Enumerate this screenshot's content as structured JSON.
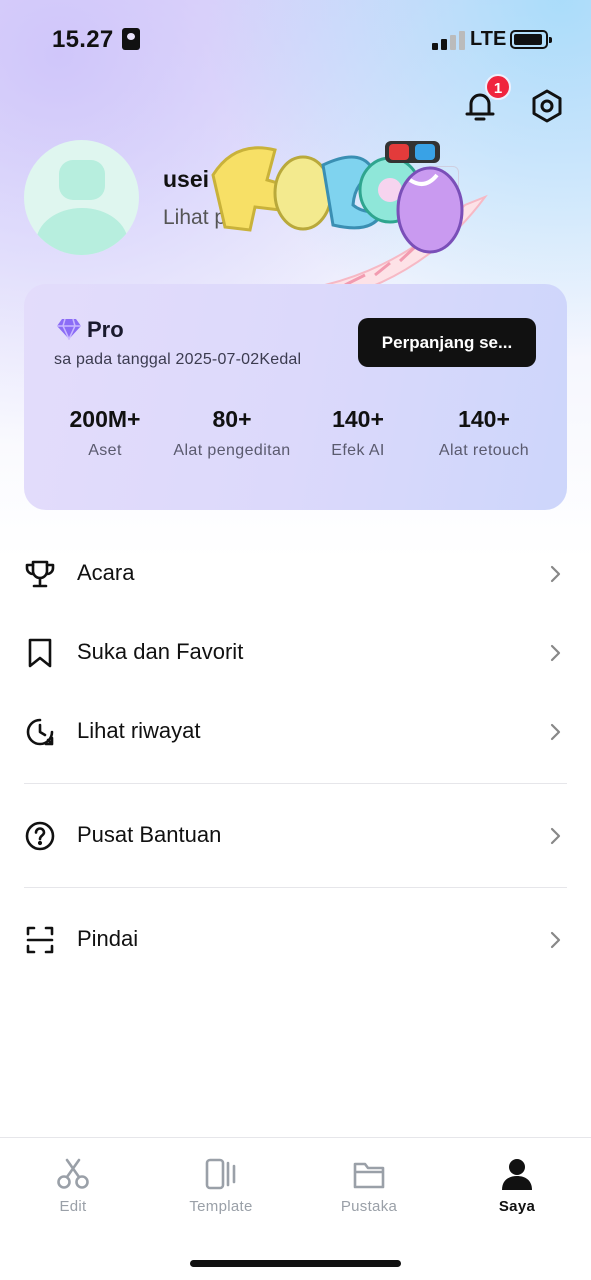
{
  "status_bar": {
    "time": "15.27",
    "network": "LTE"
  },
  "header": {
    "notification_count": "1",
    "icons": [
      "bell-icon",
      "settings-icon"
    ]
  },
  "profile": {
    "username": "usei",
    "link_text": "Lihat p",
    "id_chip": "o"
  },
  "pro_card": {
    "title": "Pro",
    "expiry_text": "sa pada tanggal 2025-07-02Kedal",
    "renew_button": "Perpanjang se...",
    "stats": [
      {
        "value": "200M+",
        "label": "Aset"
      },
      {
        "value": "80+",
        "label": "Alat pengeditan"
      },
      {
        "value": "140+",
        "label": "Efek AI"
      },
      {
        "value": "140+",
        "label": "Alat retouch"
      }
    ]
  },
  "menu": {
    "items": [
      {
        "label": "Acara",
        "icon": "trophy-icon"
      },
      {
        "label": "Suka dan Favorit",
        "icon": "bookmark-icon"
      },
      {
        "label": "Lihat riwayat",
        "icon": "history-icon"
      },
      {
        "label": "Pusat Bantuan",
        "icon": "help-icon"
      },
      {
        "label": "Pindai",
        "icon": "scan-icon"
      }
    ]
  },
  "bottom_nav": {
    "items": [
      {
        "label": "Edit",
        "icon": "scissors-icon"
      },
      {
        "label": "Template",
        "icon": "template-icon"
      },
      {
        "label": "Pustaka",
        "icon": "folder-icon"
      },
      {
        "label": "Saya",
        "icon": "user-icon",
        "active": true
      }
    ]
  },
  "colors": {
    "accent_dark": "#111111",
    "badge_red": "#f0243e",
    "pro_gem": "#8b6cf6",
    "inactive_nav": "#9aa0a8"
  }
}
